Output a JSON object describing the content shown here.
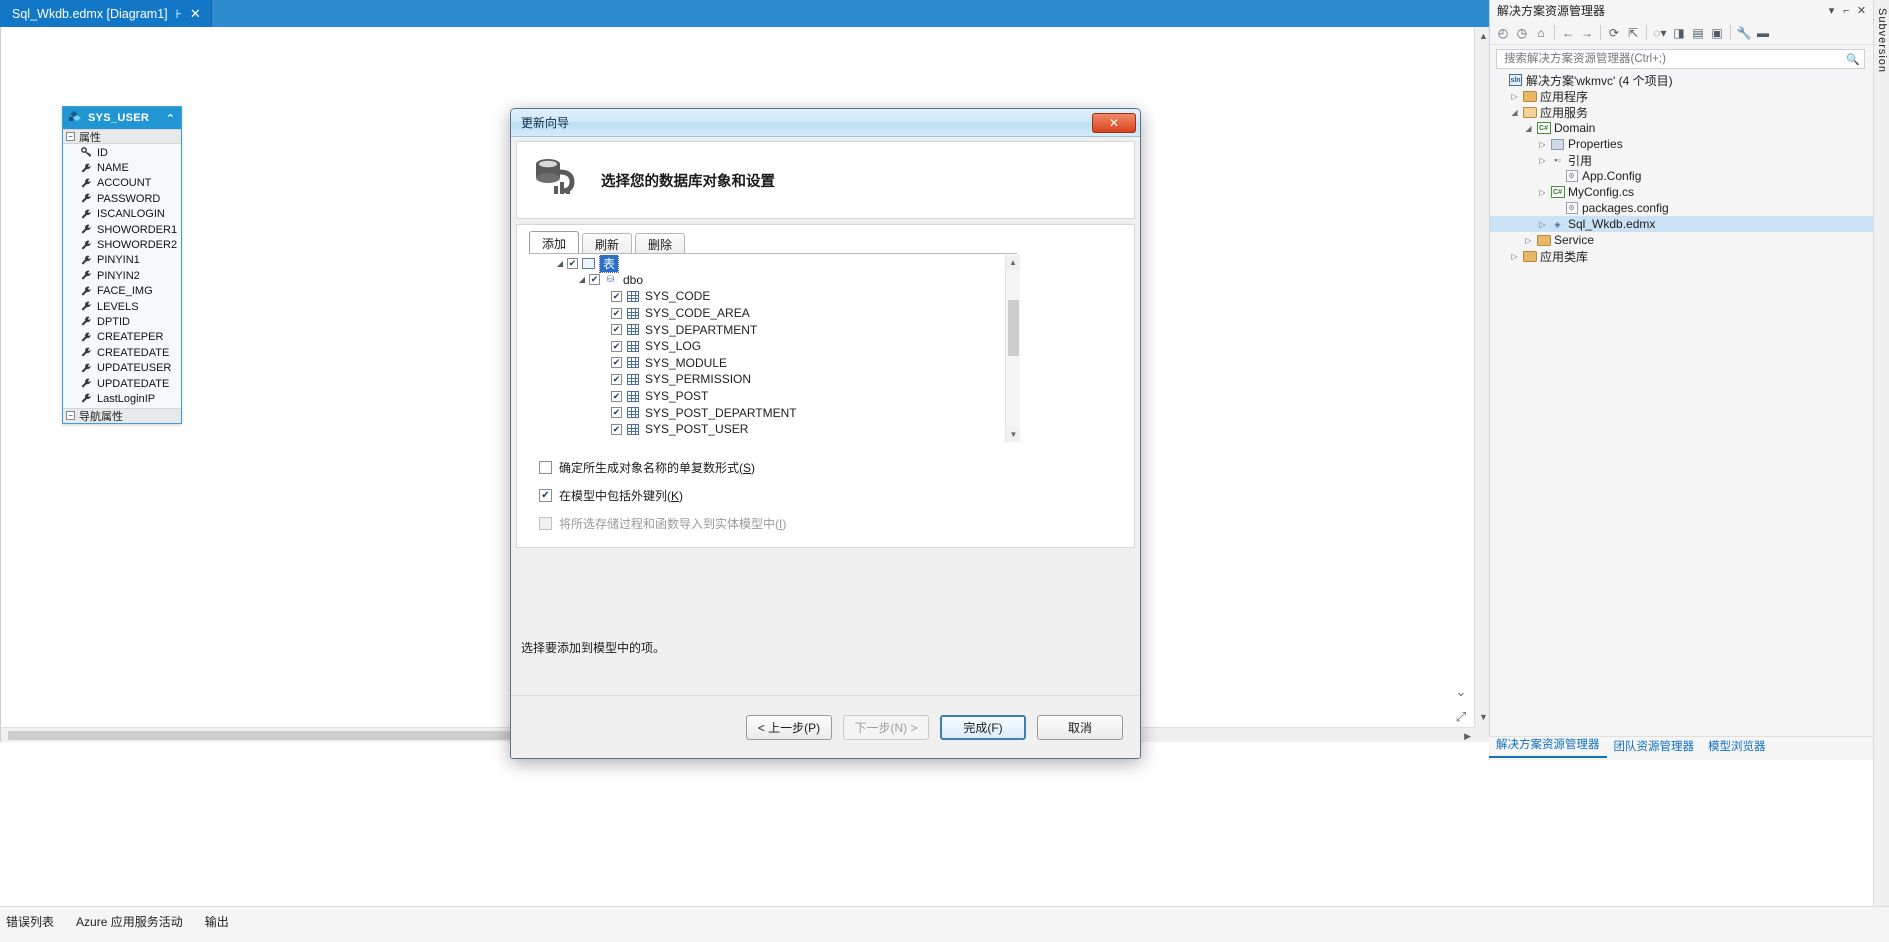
{
  "editor": {
    "tab": {
      "title": "Sql_Wkdb.edmx [Diagram1]",
      "pin": "⊦",
      "close": "✕"
    }
  },
  "entity": {
    "name": "SYS_USER",
    "collapse": "⌃",
    "groups": [
      {
        "label": "属性",
        "toggle": "−"
      }
    ],
    "properties": [
      "ID",
      "NAME",
      "ACCOUNT",
      "PASSWORD",
      "ISCANLOGIN",
      "SHOWORDER1",
      "SHOWORDER2",
      "PINYIN1",
      "PINYIN2",
      "FACE_IMG",
      "LEVELS",
      "DPTID",
      "CREATEPER",
      "CREATEDATE",
      "UPDATEUSER",
      "UPDATEDATE",
      "LastLoginIP"
    ],
    "nav_group": {
      "label": "导航属性",
      "toggle": "−"
    }
  },
  "dialog": {
    "title": "更新向导",
    "close_label": "✕",
    "heading": "选择您的数据库对象和设置",
    "tabs": [
      {
        "label": "添加",
        "active": true
      },
      {
        "label": "刷新",
        "active": false
      },
      {
        "label": "删除",
        "active": false
      }
    ],
    "tree": {
      "root": {
        "label": "表",
        "checked": true,
        "selected": true,
        "expander": "◢"
      },
      "schema": {
        "label": "dbo",
        "checked": true,
        "expander": "◢"
      },
      "tables": [
        {
          "label": "SYS_CODE",
          "checked": true
        },
        {
          "label": "SYS_CODE_AREA",
          "checked": true
        },
        {
          "label": "SYS_DEPARTMENT",
          "checked": true
        },
        {
          "label": "SYS_LOG",
          "checked": true
        },
        {
          "label": "SYS_MODULE",
          "checked": true
        },
        {
          "label": "SYS_PERMISSION",
          "checked": true
        },
        {
          "label": "SYS_POST",
          "checked": true
        },
        {
          "label": "SYS_POST_DEPARTMENT",
          "checked": true
        },
        {
          "label": "SYS_POST_USER",
          "checked": true
        }
      ]
    },
    "options": [
      {
        "text": "确定所生成对象名称的单复数形式(",
        "accel": "S",
        "suffix": ")",
        "checked": false,
        "disabled": false
      },
      {
        "text": "在模型中包括外键列(",
        "accel": "K",
        "suffix": ")",
        "checked": true,
        "disabled": false
      },
      {
        "text": "将所选存储过程和函数导入到实体模型中(",
        "accel": "I",
        "suffix": ")",
        "checked": false,
        "disabled": true
      }
    ],
    "status": "选择要添加到模型中的项。",
    "buttons": [
      {
        "label": "< 上一步(P)",
        "state": "normal"
      },
      {
        "label": "下一步(N) >",
        "state": "disabled"
      },
      {
        "label": "完成(F)",
        "state": "primary"
      },
      {
        "label": "取消",
        "state": "normal"
      }
    ]
  },
  "solution_explorer": {
    "title": "解决方案资源管理器",
    "window_buttons": [
      "▾",
      "⌐",
      "✕"
    ],
    "toolbar_icons": [
      "back-icon",
      "forward-icon",
      "home-icon",
      "refresh-icon",
      "collapse-all-icon",
      "show-all-files-icon",
      "view-code-icon",
      "properties-icon",
      "preview-icon",
      "wrench-icon",
      "dash-icon"
    ],
    "search": {
      "placeholder": "搜索解决方案资源管理器(Ctrl+;)",
      "value": "",
      "icon": "search-icon"
    },
    "tree": [
      {
        "label": "解决方案'wkmvc' (4 个项目)",
        "indent": 0,
        "expander": "",
        "icon": "solution-icon",
        "selected": false
      },
      {
        "label": "应用程序",
        "indent": 1,
        "expander": "▷",
        "icon": "folder-icon",
        "selected": false
      },
      {
        "label": "应用服务",
        "indent": 1,
        "expander": "◢",
        "icon": "folder-open-icon",
        "selected": false
      },
      {
        "label": "Domain",
        "indent": 2,
        "expander": "◢",
        "icon": "csharp-project-icon",
        "selected": false
      },
      {
        "label": "Properties",
        "indent": 3,
        "expander": "▷",
        "icon": "properties-icon",
        "selected": false
      },
      {
        "label": "引用",
        "indent": 3,
        "expander": "▷",
        "icon": "references-icon",
        "selected": false
      },
      {
        "label": "App.Config",
        "indent": 4,
        "expander": "",
        "icon": "config-icon",
        "selected": false
      },
      {
        "label": "MyConfig.cs",
        "indent": 3,
        "expander": "▷",
        "icon": "csharp-file-icon",
        "selected": false
      },
      {
        "label": "packages.config",
        "indent": 4,
        "expander": "",
        "icon": "config-icon",
        "selected": false
      },
      {
        "label": "Sql_Wkdb.edmx",
        "indent": 3,
        "expander": "▷",
        "icon": "edmx-icon",
        "selected": true
      },
      {
        "label": "Service",
        "indent": 2,
        "expander": "▷",
        "icon": "folder-icon",
        "selected": false
      },
      {
        "label": "应用类库",
        "indent": 1,
        "expander": "▷",
        "icon": "folder-icon",
        "selected": false
      }
    ],
    "bottom_tabs": [
      {
        "label": "解决方案资源管理器",
        "active": true
      },
      {
        "label": "团队资源管理器",
        "active": false
      },
      {
        "label": "模型浏览器",
        "active": false
      }
    ]
  },
  "right_strip": {
    "label": "Subversion"
  },
  "bottom_bar": {
    "items": [
      "错误列表",
      "Azure 应用服务活动",
      "输出"
    ]
  },
  "designer": {
    "zoom_icons": [
      "zoom-in-icon",
      "zoom-fit-icon",
      "zoom-out-icon"
    ]
  },
  "colors": {
    "tab_active": "#1177c6",
    "tabstrip": "#2d8ccd",
    "entity_header": "#2196d3",
    "selection": "#2a6fc9",
    "solex_selection": "#cbe1f5",
    "link": "#0e70c0"
  }
}
